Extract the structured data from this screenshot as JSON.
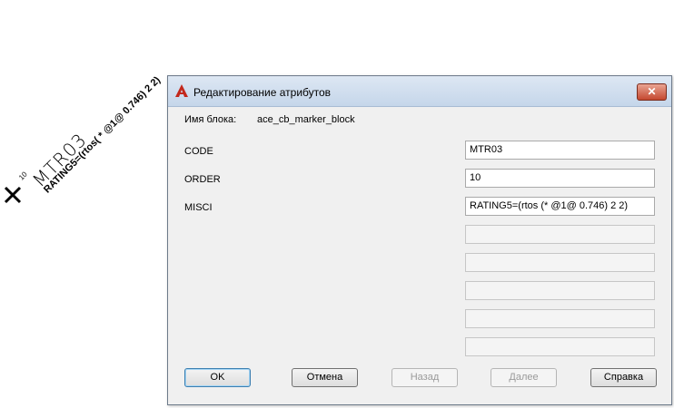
{
  "drawing": {
    "marker_label": "MTR03",
    "marker_sup": "10",
    "rating_text": "RATING5=(rtos( * @1@ 0.746) 2 2)"
  },
  "dialog": {
    "title": "Редактирование атрибутов",
    "close_symbol": "✕",
    "block_name_label": "Имя блока:",
    "block_name_value": "ace_cb_marker_block",
    "attributes": [
      {
        "tag": "CODE",
        "value": "MTR03"
      },
      {
        "tag": "ORDER",
        "value": "10"
      },
      {
        "tag": "MISCI",
        "value": "RATING5=(rtos (* @1@ 0.746) 2 2)"
      }
    ],
    "buttons": {
      "ok": "OK",
      "cancel": "Отмена",
      "back": "Назад",
      "next": "Далее",
      "help": "Справка"
    }
  },
  "colors": {
    "app_icon": "#c3281c",
    "close_button": "#c4482f"
  },
  "icons": {
    "app": "autocad-a-icon",
    "marker": "x-marker-icon"
  }
}
